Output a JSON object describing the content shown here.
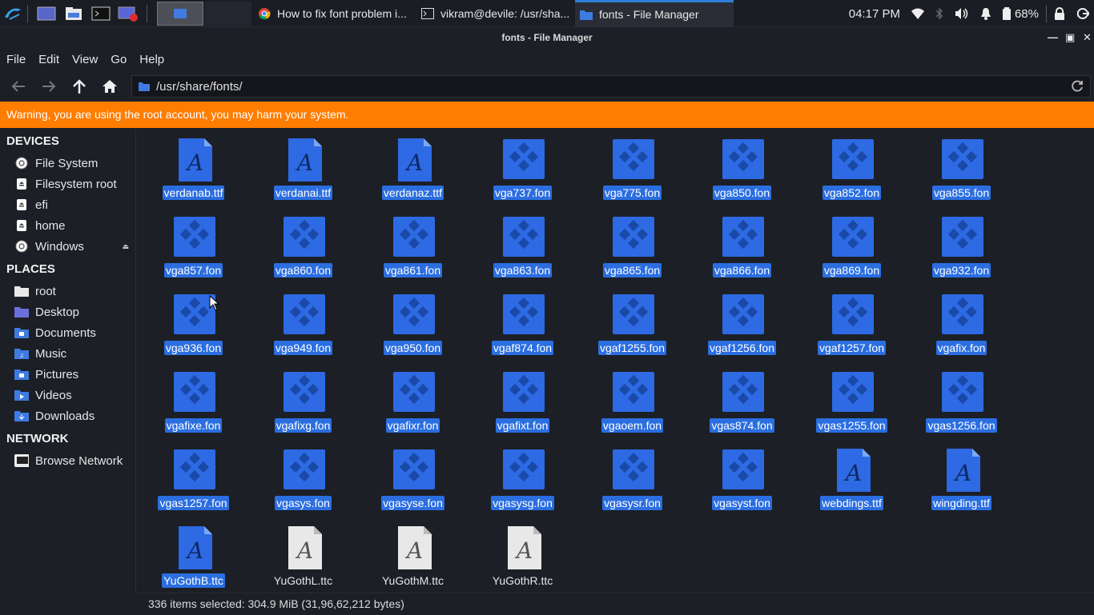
{
  "panel": {
    "tasks": [
      {
        "label": "How to fix font problem i...",
        "icon": "chrome-icon"
      },
      {
        "label": "vikram@devile: /usr/sha...",
        "icon": "terminal-icon"
      },
      {
        "label": "fonts - File Manager",
        "icon": "folder-icon"
      }
    ],
    "clock": "04:17 PM",
    "battery": "68%"
  },
  "window": {
    "title": "fonts - File Manager"
  },
  "menu": [
    "File",
    "Edit",
    "View",
    "Go",
    "Help"
  ],
  "address": {
    "path": "/usr/share/fonts/"
  },
  "warning": "Warning, you are using the root account, you may harm your system.",
  "sidebar": {
    "devices_title": "DEVICES",
    "devices": [
      {
        "label": "File System",
        "icon": "disk-icon"
      },
      {
        "label": "Filesystem root",
        "icon": "drive-icon"
      },
      {
        "label": "efi",
        "icon": "drive-icon"
      },
      {
        "label": "home",
        "icon": "drive-icon"
      },
      {
        "label": "Windows",
        "icon": "disk-icon"
      }
    ],
    "places_title": "PLACES",
    "places": [
      {
        "label": "root",
        "icon": "home-folder-icon"
      },
      {
        "label": "Desktop",
        "icon": "desktop-folder-icon"
      },
      {
        "label": "Documents",
        "icon": "documents-folder-icon"
      },
      {
        "label": "Music",
        "icon": "music-folder-icon"
      },
      {
        "label": "Pictures",
        "icon": "pictures-folder-icon"
      },
      {
        "label": "Videos",
        "icon": "videos-folder-icon"
      },
      {
        "label": "Downloads",
        "icon": "downloads-folder-icon"
      }
    ],
    "network_title": "NETWORK",
    "network": [
      {
        "label": "Browse Network",
        "icon": "network-icon"
      }
    ]
  },
  "files": [
    {
      "name": "verdanab.ttf",
      "type": "ttf",
      "selected": true
    },
    {
      "name": "verdanai.ttf",
      "type": "ttf",
      "selected": true
    },
    {
      "name": "verdanaz.ttf",
      "type": "ttf",
      "selected": true
    },
    {
      "name": "vga737.fon",
      "type": "fon",
      "selected": true
    },
    {
      "name": "vga775.fon",
      "type": "fon",
      "selected": true
    },
    {
      "name": "vga850.fon",
      "type": "fon",
      "selected": true
    },
    {
      "name": "vga852.fon",
      "type": "fon",
      "selected": true
    },
    {
      "name": "vga855.fon",
      "type": "fon",
      "selected": true
    },
    {
      "name": "vga857.fon",
      "type": "fon",
      "selected": true
    },
    {
      "name": "vga860.fon",
      "type": "fon",
      "selected": true
    },
    {
      "name": "vga861.fon",
      "type": "fon",
      "selected": true
    },
    {
      "name": "vga863.fon",
      "type": "fon",
      "selected": true
    },
    {
      "name": "vga865.fon",
      "type": "fon",
      "selected": true
    },
    {
      "name": "vga866.fon",
      "type": "fon",
      "selected": true
    },
    {
      "name": "vga869.fon",
      "type": "fon",
      "selected": true
    },
    {
      "name": "vga932.fon",
      "type": "fon",
      "selected": true
    },
    {
      "name": "vga936.fon",
      "type": "fon",
      "selected": true
    },
    {
      "name": "vga949.fon",
      "type": "fon",
      "selected": true
    },
    {
      "name": "vga950.fon",
      "type": "fon",
      "selected": true
    },
    {
      "name": "vgaf874.fon",
      "type": "fon",
      "selected": true
    },
    {
      "name": "vgaf1255.fon",
      "type": "fon",
      "selected": true
    },
    {
      "name": "vgaf1256.fon",
      "type": "fon",
      "selected": true
    },
    {
      "name": "vgaf1257.fon",
      "type": "fon",
      "selected": true
    },
    {
      "name": "vgafix.fon",
      "type": "fon",
      "selected": true
    },
    {
      "name": "vgafixe.fon",
      "type": "fon",
      "selected": true
    },
    {
      "name": "vgafixg.fon",
      "type": "fon",
      "selected": true
    },
    {
      "name": "vgafixr.fon",
      "type": "fon",
      "selected": true
    },
    {
      "name": "vgafixt.fon",
      "type": "fon",
      "selected": true
    },
    {
      "name": "vgaoem.fon",
      "type": "fon",
      "selected": true
    },
    {
      "name": "vgas874.fon",
      "type": "fon",
      "selected": true
    },
    {
      "name": "vgas1255.fon",
      "type": "fon",
      "selected": true
    },
    {
      "name": "vgas1256.fon",
      "type": "fon",
      "selected": true
    },
    {
      "name": "vgas1257.fon",
      "type": "fon",
      "selected": true
    },
    {
      "name": "vgasys.fon",
      "type": "fon",
      "selected": true
    },
    {
      "name": "vgasyse.fon",
      "type": "fon",
      "selected": true
    },
    {
      "name": "vgasysg.fon",
      "type": "fon",
      "selected": true
    },
    {
      "name": "vgasysr.fon",
      "type": "fon",
      "selected": true
    },
    {
      "name": "vgasyst.fon",
      "type": "fon",
      "selected": true
    },
    {
      "name": "webdings.ttf",
      "type": "ttf",
      "selected": true
    },
    {
      "name": "wingding.ttf",
      "type": "ttf",
      "selected": true
    },
    {
      "name": "YuGothB.ttc",
      "type": "ttf",
      "selected": true
    },
    {
      "name": "YuGothL.ttc",
      "type": "ttc-plain",
      "selected": false
    },
    {
      "name": "YuGothM.ttc",
      "type": "ttc-plain",
      "selected": false
    },
    {
      "name": "YuGothR.ttc",
      "type": "ttc-plain",
      "selected": false
    }
  ],
  "status": "336 items selected: 304.9 MiB (31,96,62,212 bytes)",
  "colors": {
    "accent": "#2b6ee0",
    "warning": "#ff7d00",
    "icon_blue": "#2d6ae3"
  }
}
